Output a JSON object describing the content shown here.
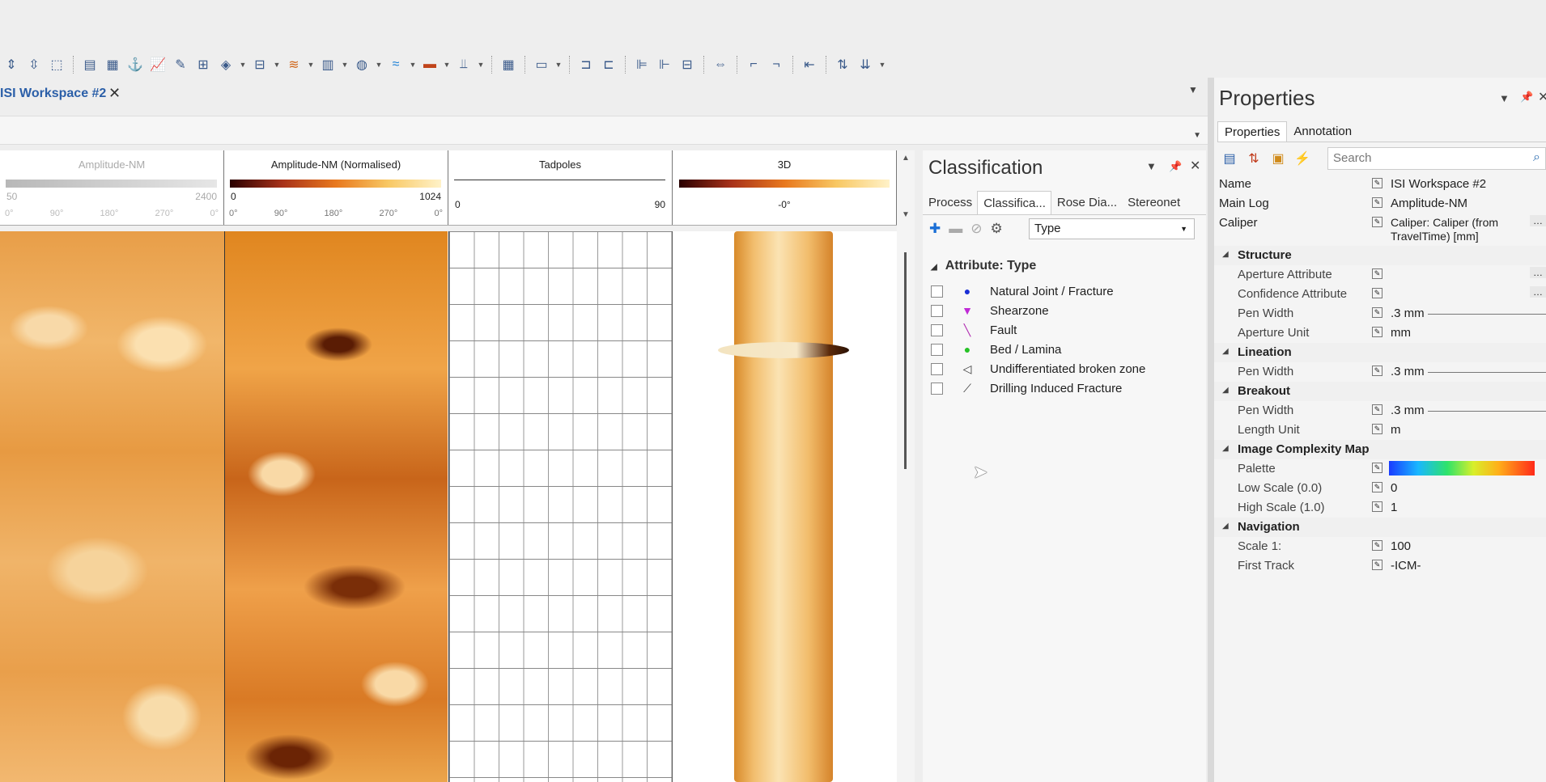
{
  "toolbar": {
    "icons": [
      "move-icon",
      "fit-height-icon",
      "select-icon",
      "log-icon",
      "table-icon",
      "anchor-icon",
      "chart-icon",
      "erase-icon",
      "grid-icon",
      "bucket-icon",
      "layout-icon",
      "fracture-icon",
      "column-icon",
      "stereonet-icon",
      "waves-icon",
      "colormap-icon",
      "trend-icon",
      "track-grid-icon",
      "panel-icon",
      "align-tracks-icon",
      "align-left-icon",
      "align-right-icon",
      "align-center-icon",
      "resize-icon",
      "tops-up-icon",
      "tops-down-icon",
      "indent-icon",
      "sort-up-icon",
      "sort-down-icon"
    ]
  },
  "workspace": {
    "tab_title": "ISI Workspace #2",
    "close_glyph": "✕"
  },
  "tracks": [
    {
      "name": "Amplitude-NM",
      "lo": "50",
      "hi": "2400",
      "ticks": [
        "0°",
        "90°",
        "180°",
        "270°",
        "0°"
      ]
    },
    {
      "name": "Amplitude-NM (Normalised)",
      "lo": "0",
      "hi": "1024",
      "ticks": [
        "0°",
        "90°",
        "180°",
        "270°",
        "0°"
      ]
    },
    {
      "name": "Tadpoles",
      "lo": "0",
      "hi": "90"
    },
    {
      "name": "3D",
      "mid": "-0°"
    }
  ],
  "classification": {
    "title": "Classification",
    "tabs": [
      "Process",
      "Classifica...",
      "Rose Dia...",
      "Stereonet"
    ],
    "type_select": "Type",
    "attribute_header": "Attribute: Type",
    "items": [
      {
        "label": "Natural Joint / Fracture",
        "color": "#1a2fd6"
      },
      {
        "label": "Shearzone",
        "color": "#c02ad6"
      },
      {
        "label": "Fault",
        "color": "#b02ab0"
      },
      {
        "label": "Bed / Lamina",
        "color": "#27c227"
      },
      {
        "label": "Undifferentiated broken zone",
        "color": "#333333"
      },
      {
        "label": "Drilling Induced Fracture",
        "color": "#333333"
      }
    ]
  },
  "properties": {
    "title": "Properties",
    "tabs": [
      "Properties",
      "Annotation"
    ],
    "search_placeholder": "Search",
    "rows": {
      "name_label": "Name",
      "name_value": "ISI Workspace #2",
      "mainlog_label": "Main Log",
      "mainlog_value": "Amplitude-NM",
      "caliper_label": "Caliper",
      "caliper_value_1": "Caliper: Caliper (from",
      "caliper_value_2": "TravelTime) [mm]",
      "structure": "Structure",
      "aperture_attr": "Aperture Attribute",
      "confidence_attr": "Confidence Attribute",
      "pen_width": "Pen Width",
      "pen_width_value": ".3 mm",
      "aperture_unit": "Aperture Unit",
      "aperture_unit_value": "mm",
      "lineation": "Lineation",
      "breakout": "Breakout",
      "length_unit": "Length Unit",
      "length_unit_value": "m",
      "icm": "Image Complexity Map",
      "palette": "Palette",
      "low_scale": "Low Scale (0.0)",
      "low_scale_value": "0",
      "high_scale": "High Scale (1.0)",
      "high_scale_value": "1",
      "navigation": "Navigation",
      "scale": "Scale 1:",
      "scale_value": "100",
      "first_track": "First Track",
      "first_track_value": "-ICM-"
    }
  }
}
